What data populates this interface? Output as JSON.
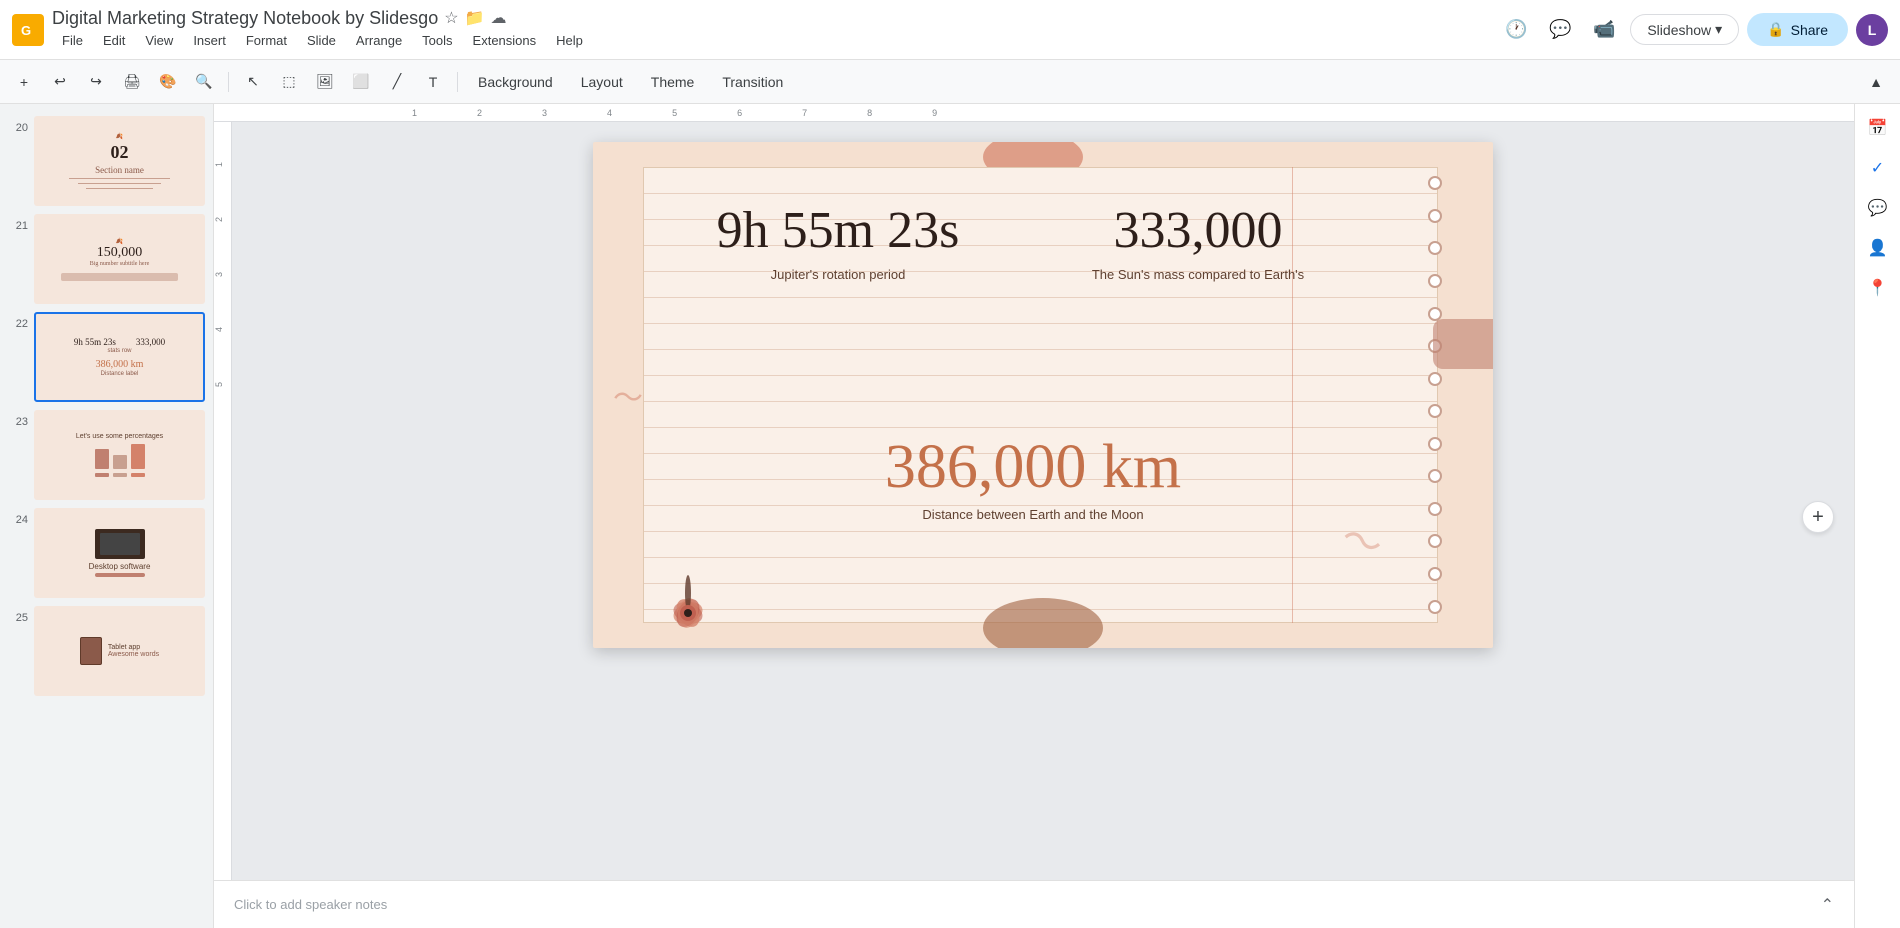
{
  "app": {
    "logo": "G",
    "title": "Digital Marketing Strategy Notebook by Slidesgo",
    "menu": [
      "File",
      "Edit",
      "View",
      "Insert",
      "Format",
      "Slide",
      "Arrange",
      "Tools",
      "Extensions",
      "Help"
    ]
  },
  "toolbar": {
    "background_label": "Background",
    "layout_label": "Layout",
    "theme_label": "Theme",
    "transition_label": "Transition"
  },
  "topright": {
    "slideshow_label": "Slideshow",
    "share_label": "Share",
    "avatar_label": "L"
  },
  "slides": [
    {
      "num": "20",
      "type": "section",
      "title": "02 Section name",
      "active": false
    },
    {
      "num": "21",
      "type": "number",
      "title": "150,000",
      "active": false
    },
    {
      "num": "22",
      "type": "stats",
      "title": "9h 55m 23s  333,000\n386,000 km",
      "active": true
    },
    {
      "num": "23",
      "type": "percentages",
      "title": "Let's use some percentages",
      "active": false
    },
    {
      "num": "24",
      "type": "desktop",
      "title": "Desktop software",
      "active": false
    },
    {
      "num": "25",
      "type": "tablet",
      "title": "Tablet app / Awesome words",
      "active": false
    }
  ],
  "slide_content": {
    "stat1_value": "9h 55m 23s",
    "stat1_label": "Jupiter's rotation period",
    "stat2_value": "333,000",
    "stat2_label": "The Sun's mass compared to Earth's",
    "stat3_value": "386,000 km",
    "stat3_label": "Distance between Earth and the Moon"
  },
  "speaker_notes": {
    "placeholder": "Click to add speaker notes"
  },
  "right_sidebar": {
    "icons": [
      "calendar",
      "check-circle",
      "chat",
      "person",
      "pin"
    ]
  }
}
